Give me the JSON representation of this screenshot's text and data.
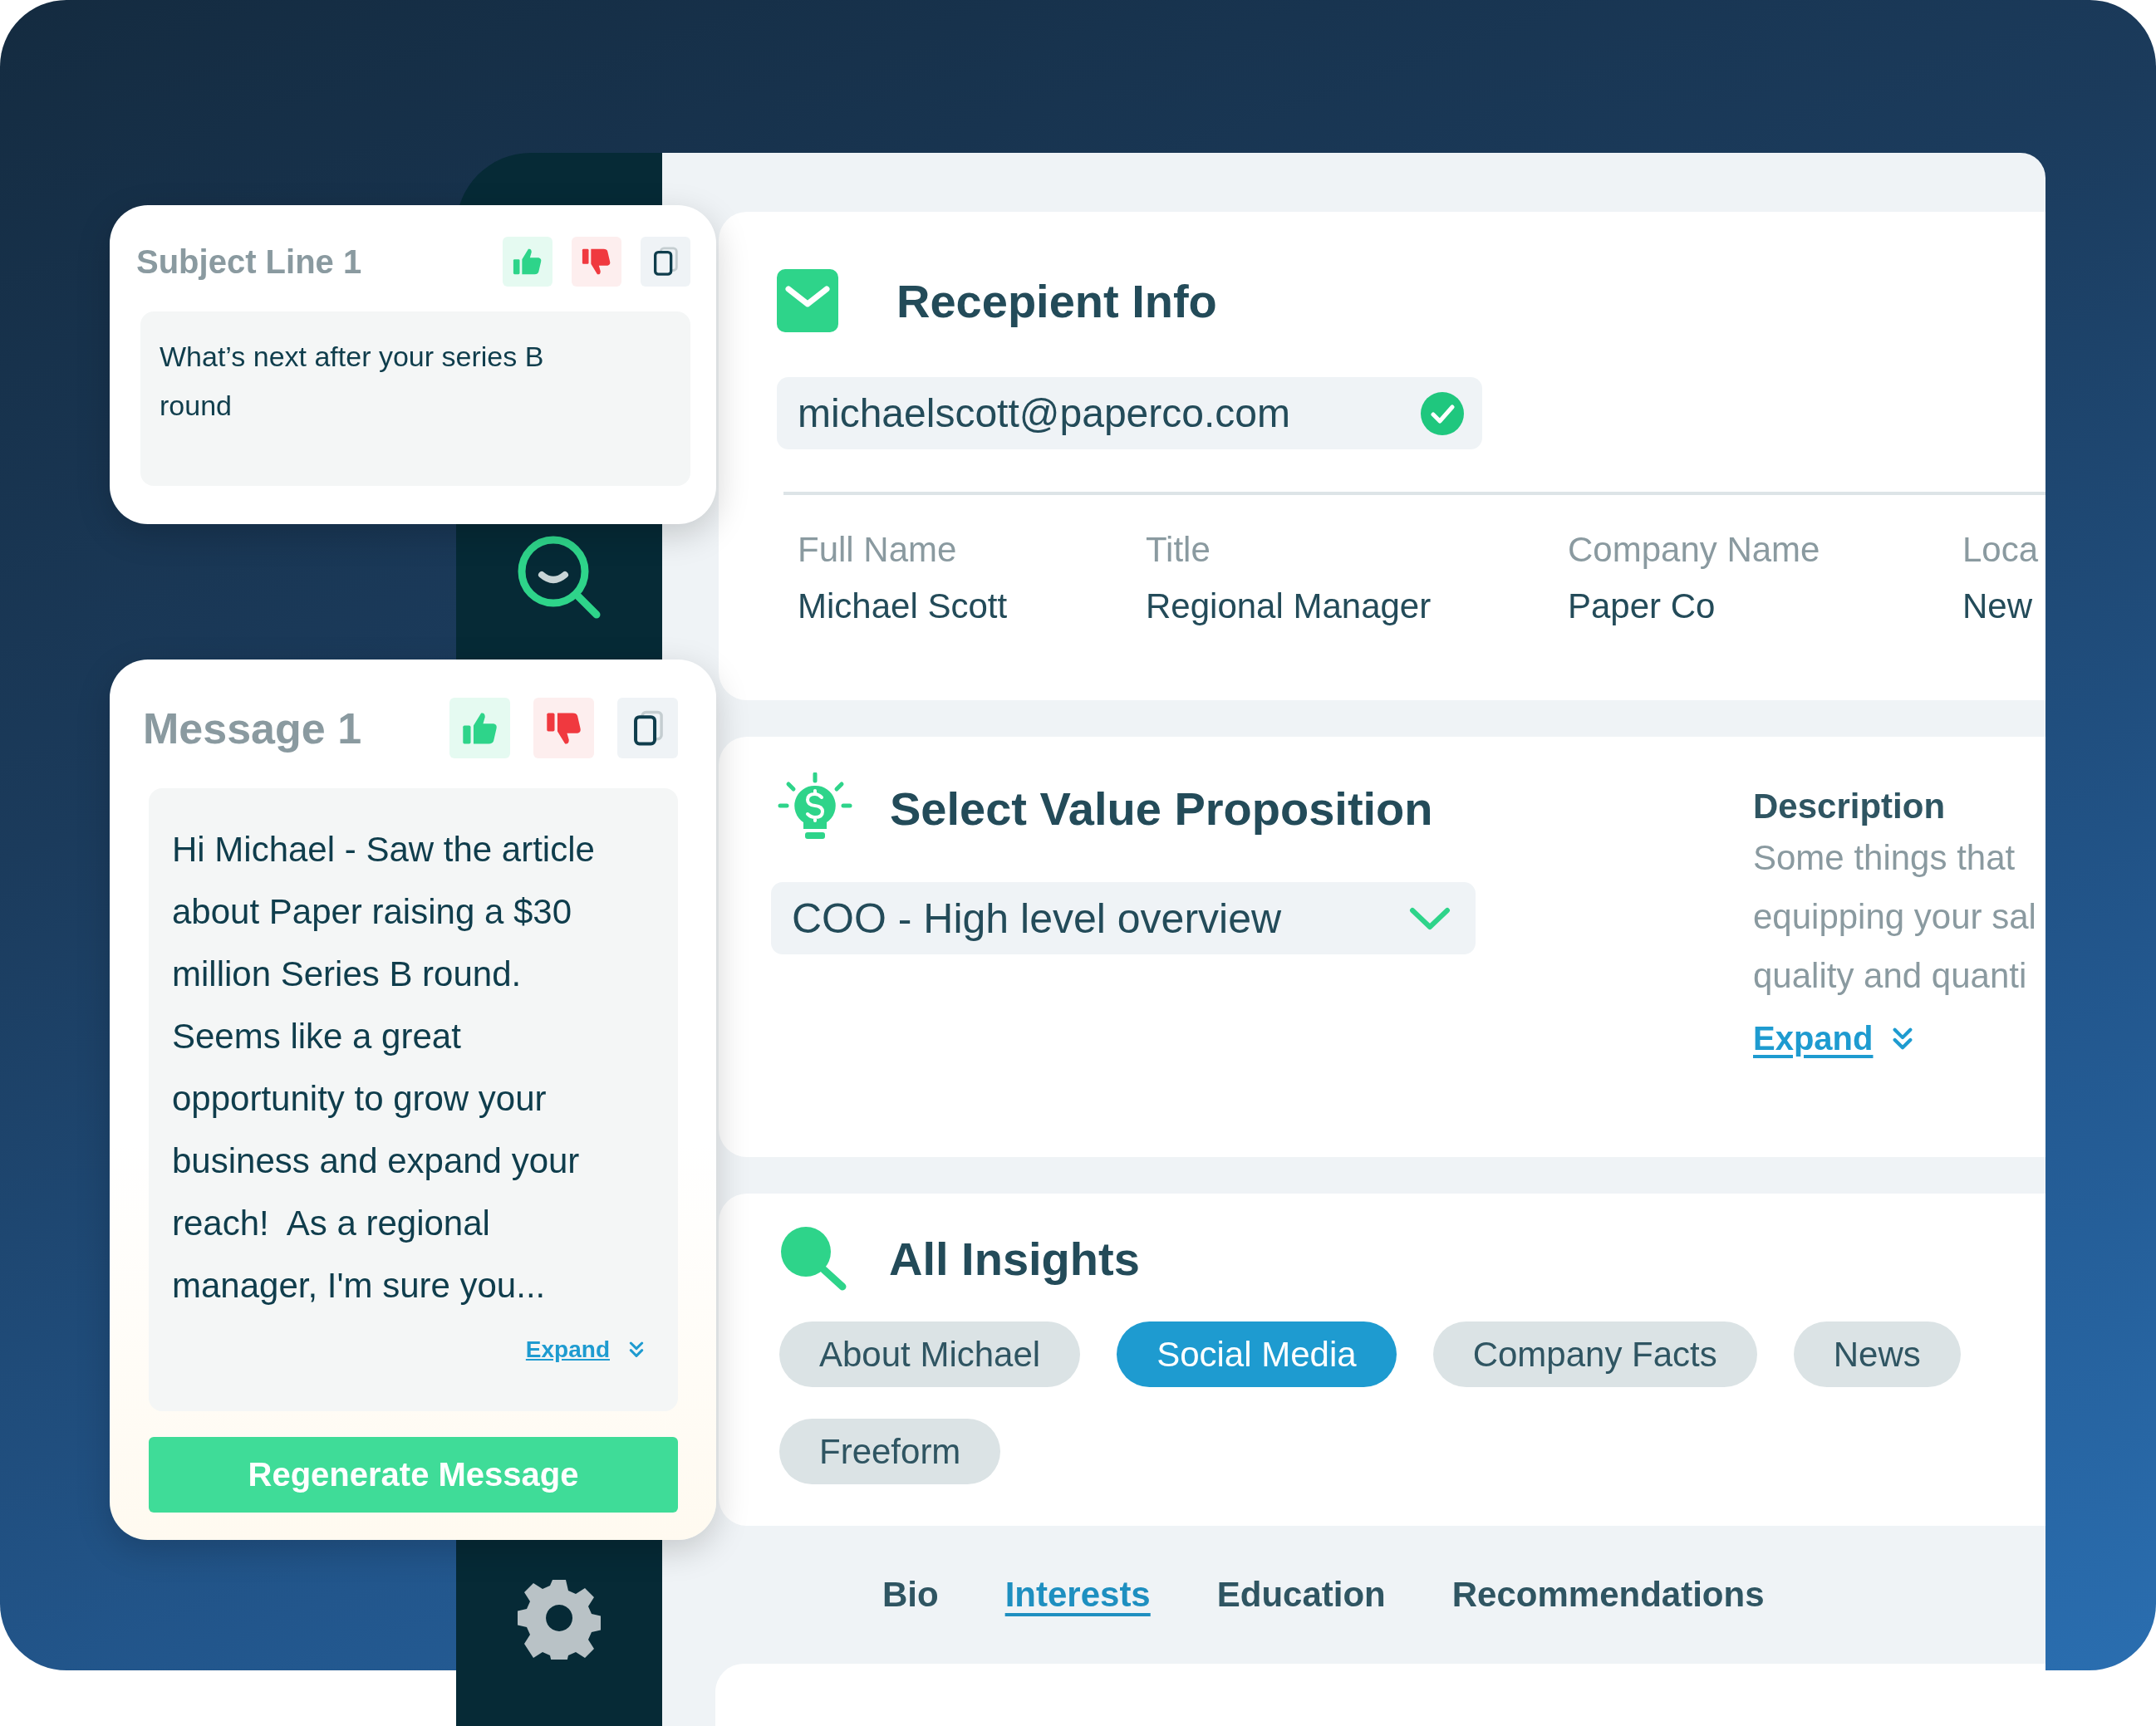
{
  "subject_card": {
    "title": "Subject Line 1",
    "text": "What’s next after your series B\nround"
  },
  "message_card": {
    "title": "Message 1",
    "text": "Hi Michael - Saw the article\nabout Paper raising a $30\nmillion Series B round.\nSeems like a great\nopportunity to grow your\nbusiness and expand your\nreach!  As a regional\nmanager, I'm sure you...",
    "expand_link": "Expand",
    "button": "Regenerate Message"
  },
  "recipient": {
    "title": "Recepient Info",
    "email": "michaelscott@paperco.com",
    "verified": true,
    "fields": [
      {
        "label": "Full Name",
        "value": "Michael Scott"
      },
      {
        "label": "Title",
        "value": "Regional Manager"
      },
      {
        "label": "Company Name",
        "value": "Paper Co"
      },
      {
        "label": "Loca",
        "value": "New"
      }
    ]
  },
  "value_proposition": {
    "title": "Select Value Proposition",
    "selected_option": "COO - High level overview",
    "description": {
      "heading": "Description",
      "text": "Some things that\nequipping your sal\nquality and quanti",
      "expand_link": "Expand"
    }
  },
  "insights": {
    "title": "All Insights",
    "chips": [
      {
        "label": "About Michael",
        "selected": false
      },
      {
        "label": "Social Media",
        "selected": true
      },
      {
        "label": "Company Facts",
        "selected": false
      },
      {
        "label": "News",
        "selected": false
      },
      {
        "label": "Freeform",
        "selected": false
      }
    ]
  },
  "tabs": [
    {
      "label": "Bio",
      "selected": false
    },
    {
      "label": "Interests",
      "selected": true
    },
    {
      "label": "Education",
      "selected": false
    },
    {
      "label": "Recommendations",
      "selected": false
    }
  ]
}
